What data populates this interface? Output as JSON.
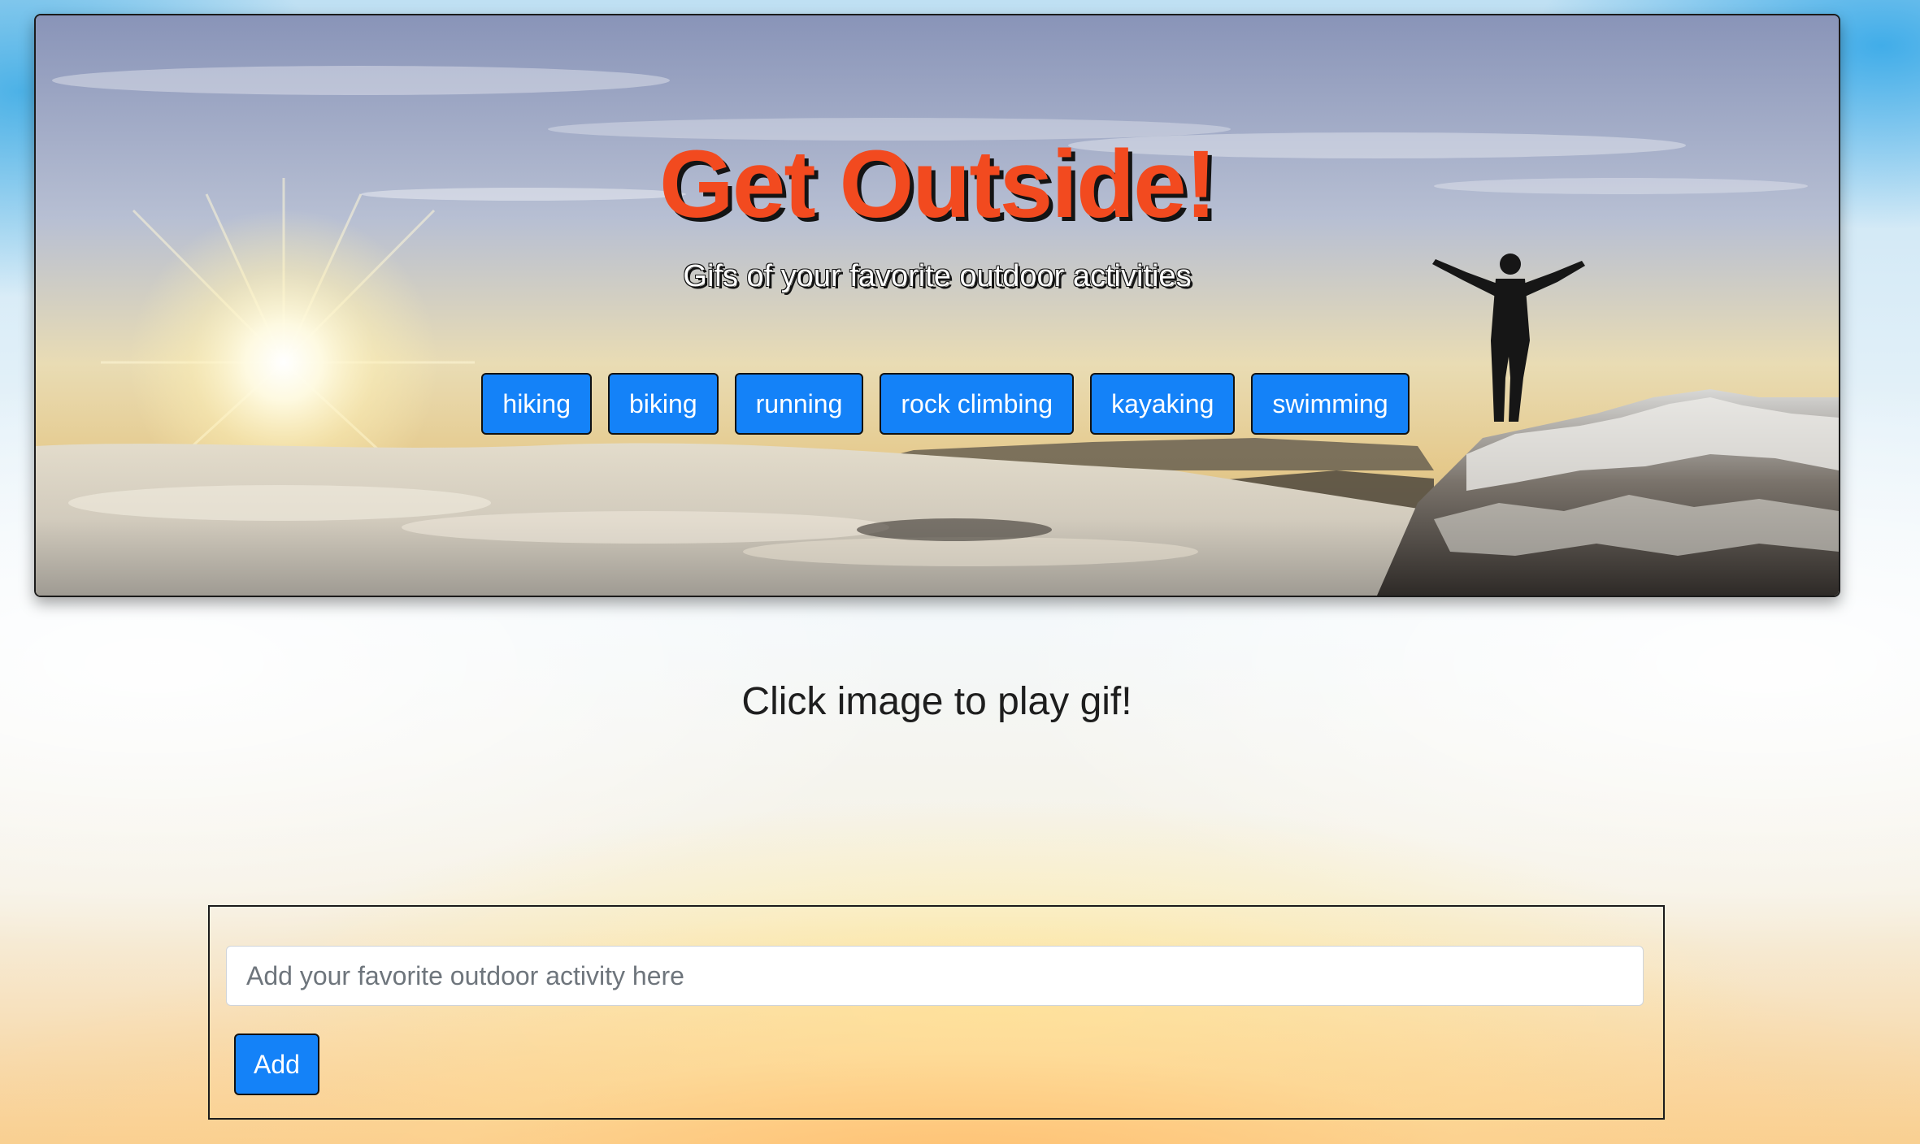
{
  "header": {
    "title": "Get Outside!",
    "subtitle": "Gifs of your favorite outdoor activities",
    "buttons": [
      "hiking",
      "biking",
      "running",
      "rock climbing",
      "kayaking",
      "swimming"
    ]
  },
  "main": {
    "instructions": "Click image to play gif!"
  },
  "form": {
    "placeholder": "Add your favorite outdoor activity here",
    "value": "",
    "add_label": "Add"
  },
  "colors": {
    "title": "#f24a1f",
    "button": "#1482f8",
    "text": "#1e1e1e"
  }
}
